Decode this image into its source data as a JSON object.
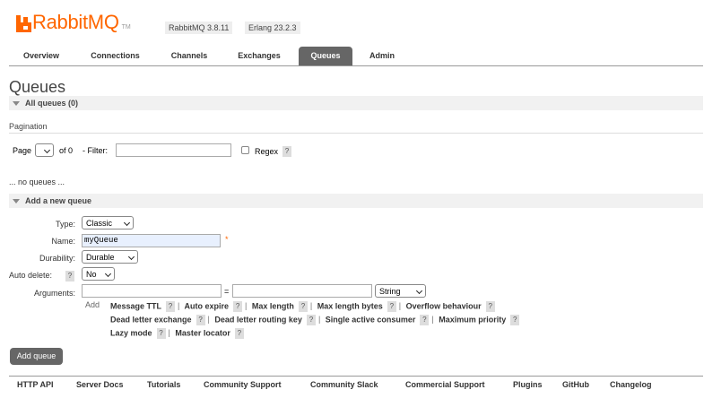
{
  "header": {
    "logo_text": "RabbitMQ",
    "logo_tm": "TM",
    "rabbitmq_version": "RabbitMQ 3.8.11",
    "erlang_version": "Erlang 23.2.3"
  },
  "nav": {
    "tabs": [
      {
        "label": "Overview",
        "active": false
      },
      {
        "label": "Connections",
        "active": false
      },
      {
        "label": "Channels",
        "active": false
      },
      {
        "label": "Exchanges",
        "active": false
      },
      {
        "label": "Queues",
        "active": true
      },
      {
        "label": "Admin",
        "active": false
      }
    ]
  },
  "page": {
    "title": "Queues",
    "all_queues_header": "All queues (0)",
    "pagination_label": "Pagination",
    "page_label": "Page",
    "page_value": "",
    "of_label": "of 0",
    "filter_label": "- Filter:",
    "filter_value": "",
    "regex_label": "Regex",
    "help_glyph": "?",
    "no_queues": "... no queues ..."
  },
  "add_queue": {
    "header": "Add a new queue",
    "type_label": "Type:",
    "type_value": "Classic",
    "name_label": "Name:",
    "name_value": "myQueue",
    "required_mark": "*",
    "durability_label": "Durability:",
    "durability_value": "Durable",
    "auto_delete_label": "Auto delete:",
    "auto_delete_value": "No",
    "arguments_label": "Arguments:",
    "arg_key": "",
    "arg_equals": "=",
    "arg_value": "",
    "arg_type": "String",
    "add_label": "Add",
    "arg_line1": [
      "Message TTL",
      "Auto expire",
      "Max length",
      "Max length bytes",
      "Overflow behaviour"
    ],
    "arg_line2": [
      "Dead letter exchange",
      "Dead letter routing key",
      "Single active consumer",
      "Maximum priority"
    ],
    "arg_line3": [
      "Lazy mode",
      "Master locator"
    ],
    "separator": "|",
    "submit_label": "Add queue"
  },
  "footer": {
    "links": [
      "HTTP API",
      "Server Docs",
      "Tutorials",
      "Community Support",
      "Community Slack",
      "Commercial Support",
      "Plugins",
      "GitHub",
      "Changelog"
    ]
  },
  "colors": {
    "brand": "#ff6600",
    "tab_active_bg": "#666666",
    "section_bg": "#f1f1f1"
  }
}
